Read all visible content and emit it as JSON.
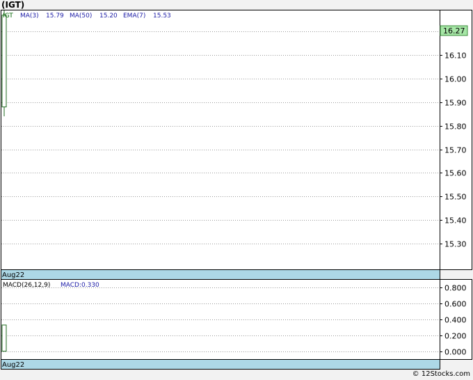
{
  "title": "(IGT)",
  "footer": "© 12Stocks.com",
  "chart_data": [
    {
      "type": "candlestick",
      "legend": {
        "symbol": "IGT",
        "items": [
          {
            "label": "MA(3)",
            "value": "15.79"
          },
          {
            "label": "MA(50)",
            "value": "15.20"
          },
          {
            "label": "EMA(7)",
            "value": "15.53"
          }
        ]
      },
      "price_badge": "16.27",
      "y_ticks": [
        "16.20",
        "16.10",
        "16.00",
        "15.90",
        "15.80",
        "15.70",
        "15.60",
        "15.50",
        "15.40",
        "15.30"
      ],
      "ylim": [
        15.19,
        16.29
      ],
      "x_label": "Aug22",
      "grid": true,
      "candles": [
        {
          "open": 15.88,
          "close": 16.27,
          "high": 16.29,
          "low": 15.84
        }
      ]
    },
    {
      "type": "bar",
      "legend": {
        "name": "MACD(26,12,9)",
        "value_label": "MACD:0.330"
      },
      "y_ticks": [
        "0.800",
        "0.600",
        "0.400",
        "0.200",
        "0.000"
      ],
      "ylim": [
        -0.1,
        0.9
      ],
      "x_label": "Aug22",
      "grid": true,
      "values": [
        0.33
      ]
    }
  ]
}
